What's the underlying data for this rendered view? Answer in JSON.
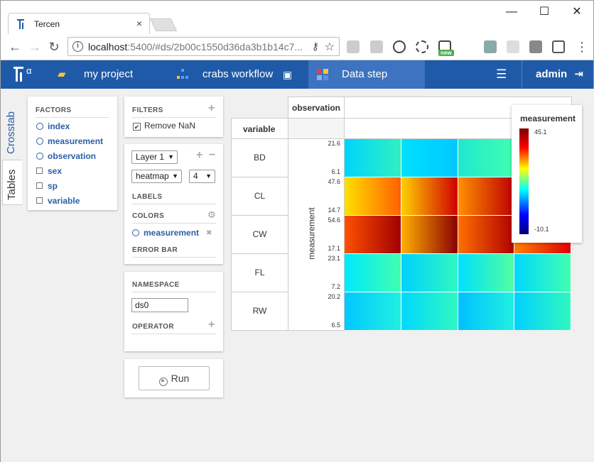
{
  "browser": {
    "tab_title": "Tercen",
    "tab_close": "×",
    "minimize": "—",
    "maximize": "☐",
    "close": "✕",
    "back": "←",
    "forward": "→",
    "reload": "↻",
    "info": "i",
    "url_host": "localhost",
    "url_rest": ":5400/#ds/2b00c1550d36da3b1b14c7...",
    "key_icon": "⚷",
    "star_icon": "☆",
    "ext_new_badge": "new"
  },
  "appbar": {
    "logo_alpha": "α",
    "project_icon": "▰",
    "project": "my project",
    "workflow": "crabs workflow",
    "save_icon": "▣",
    "step": "Data step",
    "menu_icon": "☰",
    "user": "admin",
    "logout_icon": "⇥",
    "colors": {
      "bar": "#1f5aa8",
      "active": "#3d73c0"
    }
  },
  "sidetabs": {
    "crosstab": "Crosstab",
    "tables": "Tables"
  },
  "factors": {
    "header": "FACTORS",
    "items": [
      {
        "label": "index",
        "kind": "numeric"
      },
      {
        "label": "measurement",
        "kind": "numeric"
      },
      {
        "label": "observation",
        "kind": "numeric"
      },
      {
        "label": "sex",
        "kind": "factor"
      },
      {
        "label": "sp",
        "kind": "factor"
      },
      {
        "label": "variable",
        "kind": "factor"
      }
    ]
  },
  "filters": {
    "header": "FILTERS",
    "add_icon": "+",
    "check_icon": "✔",
    "remove_nan": "Remove NaN",
    "remove_nan_checked": true
  },
  "layers": {
    "layer": "Layer 1",
    "add_icon": "+",
    "remove_icon": "−",
    "chart_type": "heatmap",
    "size": "4",
    "caret": "▼",
    "labels_header": "LABELS",
    "colors_header": "COLORS",
    "gear_icon": "⚙",
    "color_factor": "measurement",
    "remove_color_icon": "✖",
    "error_bar_header": "ERROR BAR"
  },
  "namespace": {
    "header": "NAMESPACE",
    "value": "ds0",
    "operator_header": "OPERATOR",
    "add_icon": "+"
  },
  "run": {
    "icon": "▶",
    "label": "Run"
  },
  "crosstab": {
    "col_factor": "observation",
    "row_factor": "variable",
    "y_axis_label": "measurement"
  },
  "chart_data": {
    "type": "heatmap",
    "rows": [
      {
        "label": "BD",
        "max": "21.6",
        "min": "6.1"
      },
      {
        "label": "CL",
        "max": "47.6",
        "min": "14.7"
      },
      {
        "label": "CW",
        "max": "54.6",
        "min": "17.1"
      },
      {
        "label": "FL",
        "max": "23.1",
        "min": "7.2"
      },
      {
        "label": "RW",
        "max": "20.2",
        "min": "6.5"
      }
    ],
    "column_groups": 4,
    "legend": {
      "title": "measurement",
      "max": "45.1",
      "min": "-10.1"
    },
    "row_gradients": [
      [
        "#00d4ff",
        "#30f0c0",
        "#00e0ff",
        "#00c8ff",
        "#20e8d0",
        "#40ffb0",
        "#00e8ff",
        "#30f0c0"
      ],
      [
        "#ffe000",
        "#ff6000",
        "#ffd000",
        "#d00000",
        "#ff9000",
        "#c00000",
        "#ffc000",
        "#ff5000"
      ],
      [
        "#ff5000",
        "#a00000",
        "#ffb000",
        "#8a0000",
        "#ff7000",
        "#b00000",
        "#ff8000",
        "#e00000"
      ],
      [
        "#00e8ff",
        "#40ffb0",
        "#00d0ff",
        "#30f8c0",
        "#00e0ff",
        "#50ffa0",
        "#00d8ff",
        "#40ffb0"
      ],
      [
        "#00c8ff",
        "#20f0e0",
        "#00d8ff",
        "#30f8c0",
        "#00c0ff",
        "#20f0e0",
        "#00d0ff",
        "#30f8c0"
      ]
    ]
  }
}
